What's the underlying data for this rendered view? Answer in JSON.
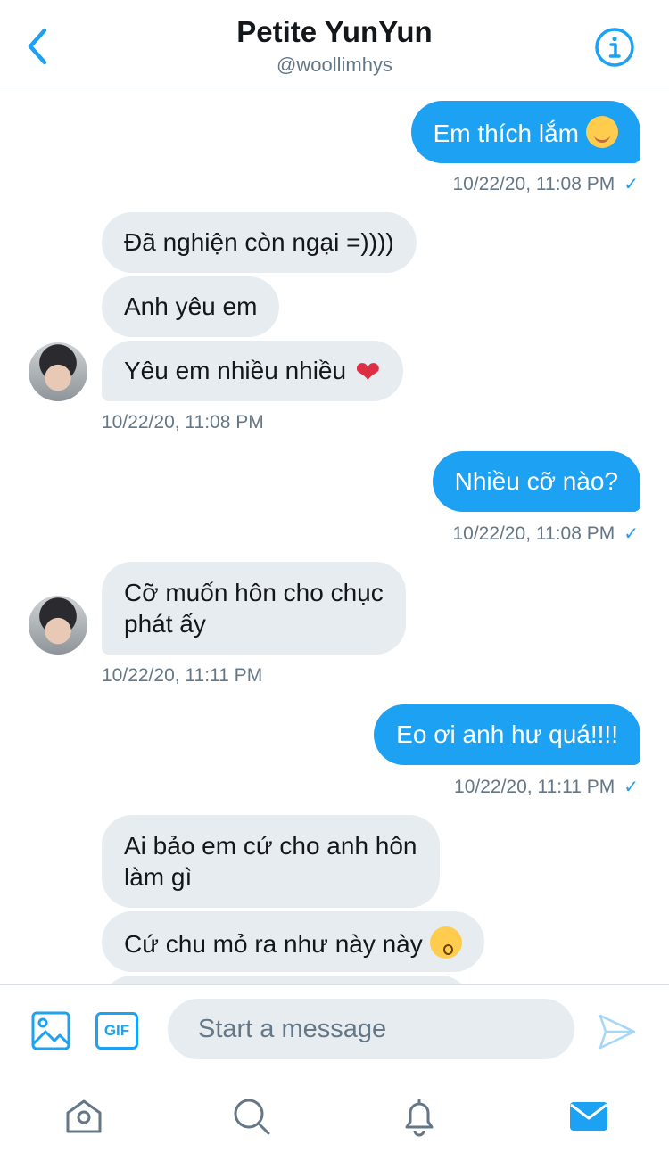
{
  "header": {
    "title": "Petite YunYun",
    "handle": "@woollimhys"
  },
  "messages": [
    {
      "text": "Em thích lắm",
      "emoji": "smiling-face-with-hearts"
    },
    {
      "time": "10/22/20, 11:08 PM"
    },
    {
      "text": "Đã nghiện còn ngại =))))"
    },
    {
      "text": "Anh yêu em"
    },
    {
      "text": "Yêu em nhiều nhiều",
      "emoji": "red-heart"
    },
    {
      "time": "10/22/20, 11:08 PM"
    },
    {
      "text": "Nhiều cỡ nào?"
    },
    {
      "time": "10/22/20, 11:08 PM"
    },
    {
      "line1": "Cỡ muốn hôn cho chục",
      "line2": "phát ấy"
    },
    {
      "time": "10/22/20, 11:11 PM"
    },
    {
      "text": "Eo ơi anh hư quá!!!!"
    },
    {
      "time": "10/22/20, 11:11 PM"
    },
    {
      "line1": "Ai bảo em cứ cho anh hôn",
      "line2": "làm gì"
    },
    {
      "text": "Cứ chu mỏ ra như này này",
      "emoji": "kissing-face"
    }
  ],
  "composer": {
    "gif_label": "GIF",
    "placeholder": "Start a message"
  },
  "nav": [
    "home-icon",
    "search-icon",
    "notifications-icon",
    "messages-icon"
  ],
  "colors": {
    "accent": "#1da1f2",
    "incoming_bubble": "#e6ecf0",
    "secondary_text": "#657786"
  }
}
